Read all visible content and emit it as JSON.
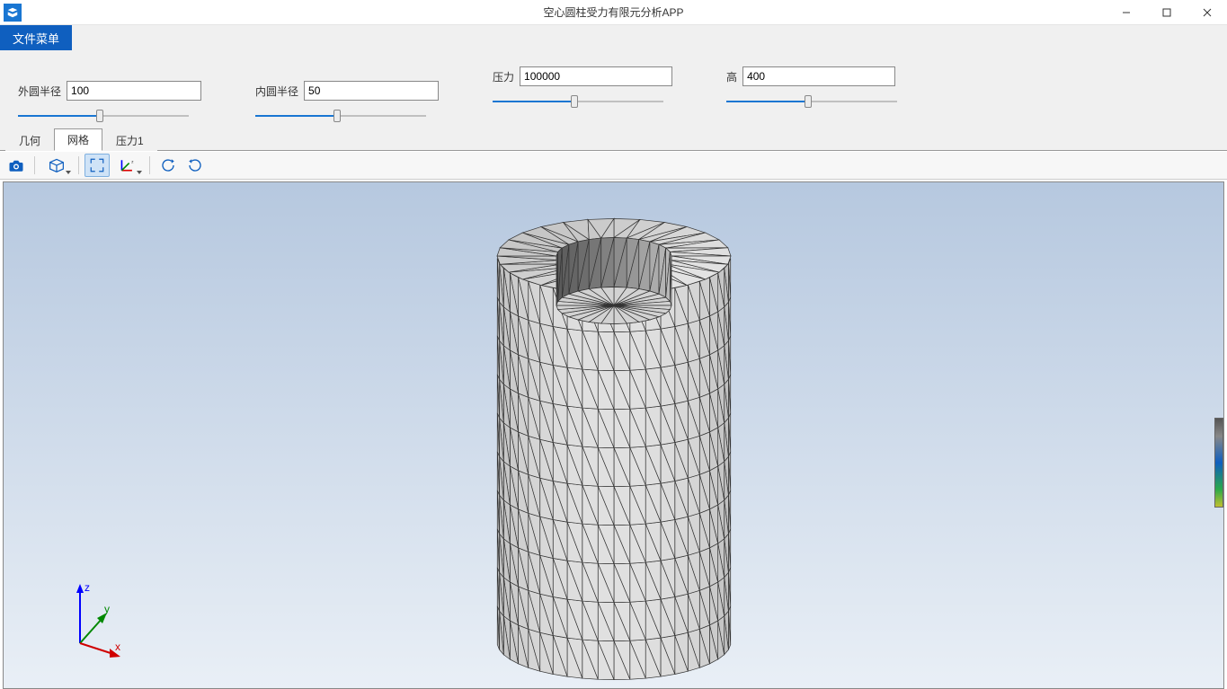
{
  "window": {
    "title": "空心圆柱受力有限元分析APP"
  },
  "menu": {
    "file": "文件菜单"
  },
  "params": {
    "outer_radius": {
      "label": "外圆半径",
      "value": "100",
      "slider_pct": 48
    },
    "inner_radius": {
      "label": "内圆半径",
      "value": "50",
      "slider_pct": 48
    },
    "pressure": {
      "label": "压力",
      "value": "100000",
      "slider_pct": 48
    },
    "height": {
      "label": "高",
      "value": "400",
      "slider_pct": 48
    }
  },
  "tabs": {
    "geometry": "几何",
    "mesh": "网格",
    "pressure": "压力1",
    "active": "mesh"
  },
  "toolbar": {
    "screenshot": "screenshot",
    "viewcube": "view-cube",
    "zoom_extents": "zoom-extents",
    "axes": "axis-triad",
    "rotate_left": "rotate-left",
    "rotate_right": "rotate-right"
  },
  "axes": {
    "x": "x",
    "y": "y",
    "z": "z"
  }
}
